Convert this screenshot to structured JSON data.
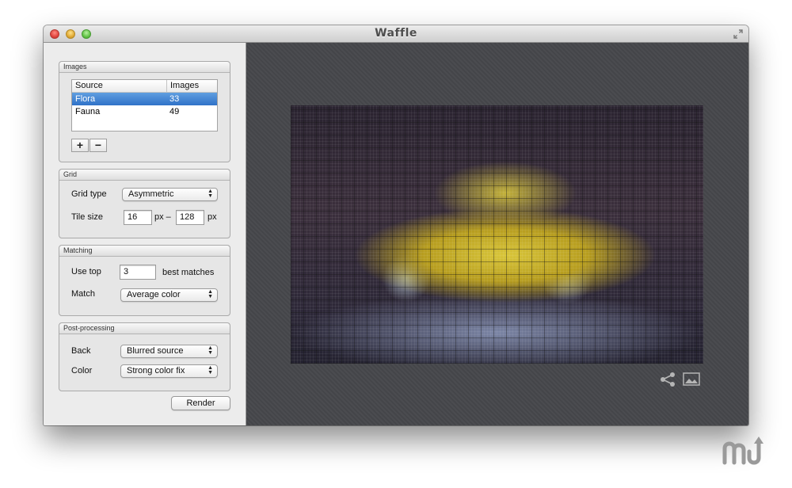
{
  "window": {
    "title": "Waffle"
  },
  "images": {
    "header": "Images",
    "columns": [
      "Source",
      "Images"
    ],
    "rows": [
      {
        "source": "Flora",
        "count": "33",
        "selected": true
      },
      {
        "source": "Fauna",
        "count": "49",
        "selected": false
      }
    ],
    "add_label": "+",
    "remove_label": "−"
  },
  "grid": {
    "header": "Grid",
    "type_label": "Grid type",
    "type_value": "Asymmetric",
    "tile_label": "Tile size",
    "tile_min": "16",
    "unit_sep": "px –",
    "tile_max": "128",
    "unit": "px"
  },
  "matching": {
    "header": "Matching",
    "use_top_label": "Use top",
    "use_top_value": "3",
    "best_matches": "best matches",
    "match_label": "Match",
    "match_value": "Average color"
  },
  "post": {
    "header": "Post-processing",
    "back_label": "Back",
    "back_value": "Blurred source",
    "color_label": "Color",
    "color_value": "Strong color fix"
  },
  "render_label": "Render",
  "icons": {
    "share": "share-icon",
    "image": "image-icon",
    "fullscreen": "fullscreen-icon"
  },
  "colors": {
    "selection": "#3d7fd0",
    "canvas": "#47484c"
  }
}
